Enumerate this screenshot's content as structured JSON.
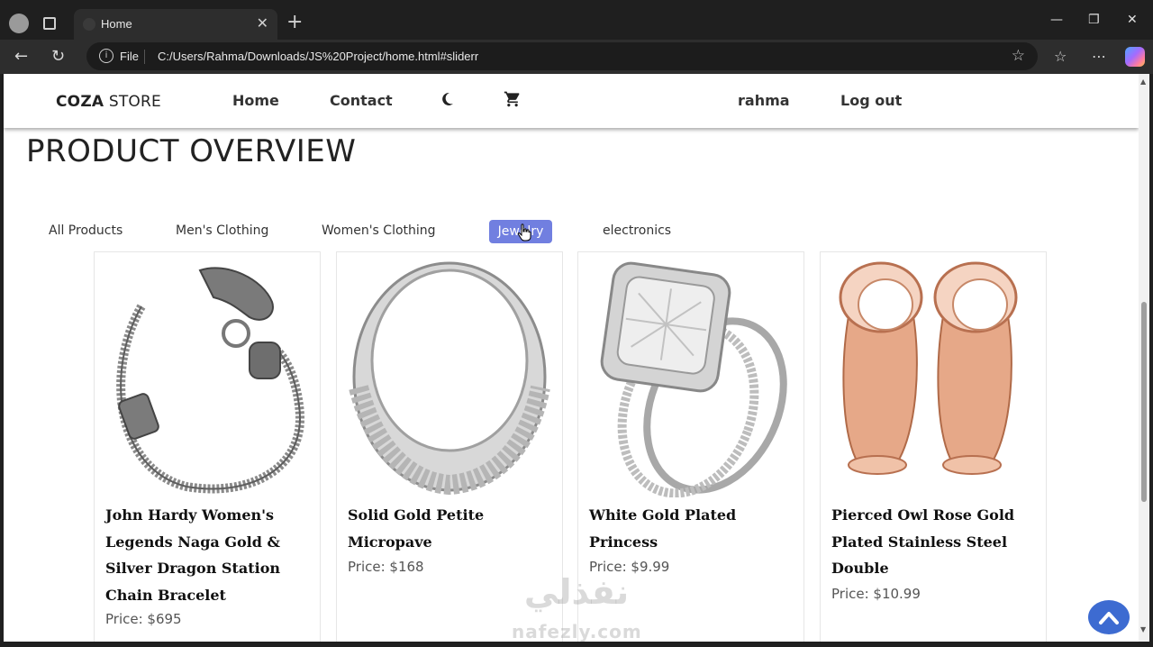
{
  "browser": {
    "tab_title": "Home",
    "tab_close": "✕",
    "new_tab": "+",
    "scheme_label": "File",
    "url": "C:/Users/Rahma/Downloads/JS%20Project/home.html#sliderr",
    "window_controls": {
      "minimize": "—",
      "maximize": "❐",
      "close": "✕"
    }
  },
  "site": {
    "logo_bold": "COZA",
    "logo_rest": " STORE",
    "nav": {
      "home": "Home",
      "contact": "Contact"
    },
    "user": {
      "name": "rahma",
      "logout": "Log out"
    }
  },
  "page": {
    "title": "PRODUCT OVERVIEW",
    "filters": {
      "all": "All Products",
      "men": "Men's Clothing",
      "women": "Women's Clothing",
      "jewelry": "Jewelry",
      "electronics": "electronics"
    },
    "active_filter": "jewelry",
    "accent_color": "#717fe0"
  },
  "products": [
    {
      "name": "John Hardy Women's Legends Naga Gold & Silver Dragon Station Chain Bracelet",
      "price": "Price: $695",
      "image_icon": "dragon-bracelet-image"
    },
    {
      "name": "Solid Gold Petite Micropave",
      "price": "Price: $168",
      "image_icon": "silver-ring-image"
    },
    {
      "name": "White Gold Plated Princess",
      "price": "Price: $9.99",
      "image_icon": "diamond-ring-set-image"
    },
    {
      "name": "Pierced Owl Rose Gold Plated Stainless Steel Double",
      "price": "Price: $10.99",
      "image_icon": "rose-gold-tunnels-image"
    }
  ],
  "watermark": {
    "arabic": "نفذلي",
    "latin": "nafezly.com"
  }
}
